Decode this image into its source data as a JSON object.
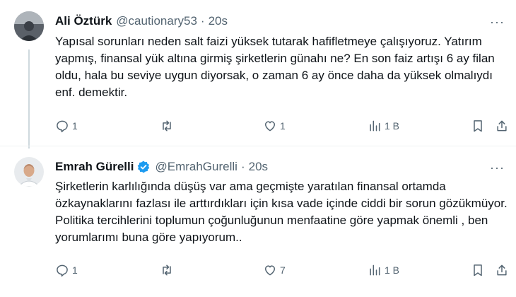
{
  "tweets": [
    {
      "name": "Ali Öztürk",
      "handle": "@cautionary53",
      "separator": "·",
      "time": "20s",
      "text": "Yapısal sorunları neden salt faizi yüksek tutarak hafifletmeye çalışıyoruz. Yatırım yapmış, finansal yük altına girmiş şirketlerin günahı ne? En son faiz artışı 6 ay filan oldu, hala bu seviye uygun diyorsak, o zaman 6 ay önce daha da yüksek olmalıydı enf. demektir.",
      "verified": false,
      "actions": {
        "replies": "1",
        "reposts": "",
        "likes": "1",
        "views": "1 B"
      }
    },
    {
      "name": "Emrah Gürelli",
      "handle": "@EmrahGurelli",
      "separator": "·",
      "time": "20s",
      "text": "Şirketlerin karlılığında düşüş var ama geçmişte yaratılan finansal ortamda özkaynaklarını fazlası ile arttırdıkları için kısa vade içinde ciddi bir sorun gözükmüyor. Politika tercihlerini toplumun çoğunluğunun menfaatine göre yapmak önemli , ben yorumlarımı buna göre yapıyorum..",
      "verified": true,
      "actions": {
        "replies": "1",
        "reposts": "",
        "likes": "7",
        "views": "1 B"
      }
    }
  ],
  "more_label": "···",
  "colors": {
    "text": "#0f1419",
    "muted": "#536471",
    "verified": "#1d9bf0",
    "divider": "#eff3f4"
  }
}
